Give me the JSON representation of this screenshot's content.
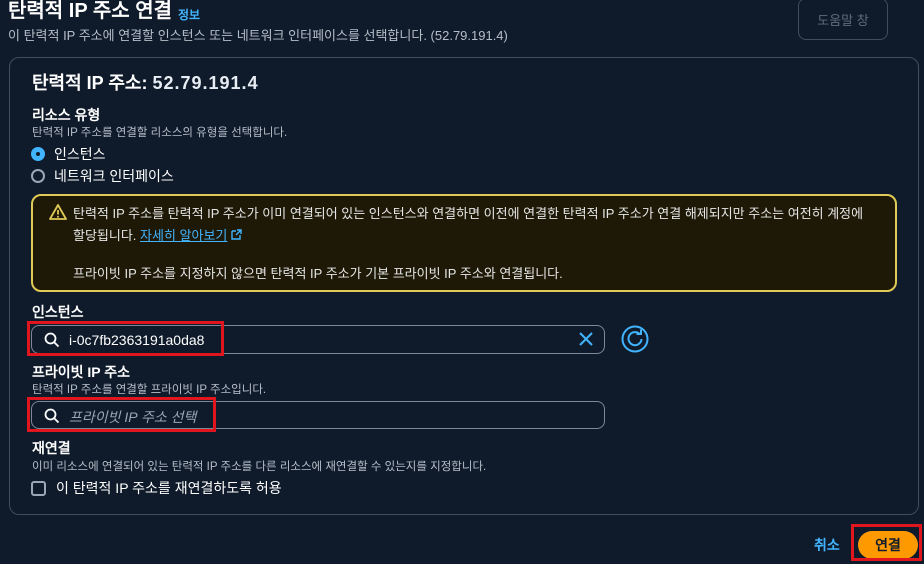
{
  "header": {
    "title": "탄력적 IP 주소 연결",
    "info_link": "정보",
    "description": "이 탄력적 IP 주소에 연결할 인스턴스 또는 네트워크 인터페이스를 선택합니다. (52.79.191.4)",
    "help_button": "도움말 창"
  },
  "panel": {
    "title_prefix": "탄력적 IP 주소: ",
    "title_value": "52.79.191.4"
  },
  "resource_type": {
    "label": "리소스 유형",
    "description": "탄력적 IP 주소를 연결할 리소스의 유형을 선택합니다.",
    "options": [
      "인스턴스",
      "네트워크 인터페이스"
    ],
    "selected": "인스턴스"
  },
  "warning": {
    "text": "탄력적 IP 주소를 탄력적 IP 주소가 이미 연결되어 있는 인스턴스와 연결하면 이전에 연결한 탄력적 IP 주소가 연결 해제되지만 주소는 여전히 계정에 할당됩니다. ",
    "link": "자세히 알아보기",
    "text2": "프라이빗 IP 주소를 지정하지 않으면 탄력적 IP 주소가 기본 프라이빗 IP 주소와 연결됩니다."
  },
  "instance": {
    "label": "인스턴스",
    "value": "i-0c7fb2363191a0da8"
  },
  "private_ip": {
    "label": "프라이빗 IP 주소",
    "description": "탄력적 IP 주소를 연결할 프라이빗 IP 주소입니다.",
    "placeholder": "프라이빗 IP 주소 선택"
  },
  "reassociation": {
    "label": "재연결",
    "description": "이미 리소스에 연결되어 있는 탄력적 IP 주소를 다른 리소스에 재연결할 수 있는지를 지정합니다.",
    "checkbox_label": "이 탄력적 IP 주소를 재연결하도록 허용"
  },
  "footer": {
    "cancel": "취소",
    "connect": "연결"
  },
  "colors": {
    "background": "#0f1b2a",
    "accent": "#42b4ff",
    "primary_button": "#ff9900",
    "warning_border": "#e0ca57",
    "highlight": "#e0161e"
  }
}
